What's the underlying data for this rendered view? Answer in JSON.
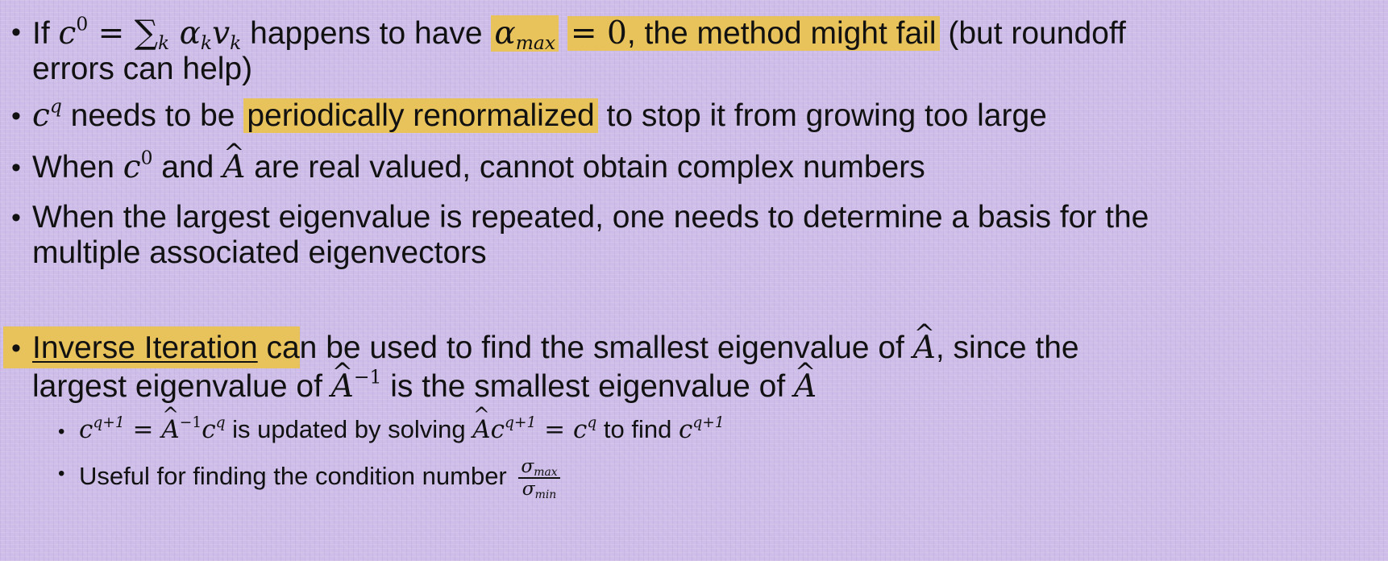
{
  "bullets": {
    "b1": {
      "t1": "If ",
      "t2": " happens to have ",
      "t3": "the method might fail",
      "t4": " (but roundoff",
      "line2": "errors can help)"
    },
    "b2": {
      "t1": " needs to be ",
      "hl": "periodically renormalized",
      "t2": " to stop it from growing too large"
    },
    "b3": {
      "t1": "When ",
      "t2": " and ",
      "t3": " are real valued, cannot obtain complex numbers"
    },
    "b4": {
      "line1": "When the largest eigenvalue is repeated, one needs to determine a basis for the",
      "line2": "multiple associated eigenvectors"
    },
    "b5": {
      "link": "Inverse Iteration",
      "t1": " can be used to find the smallest eigenvalue of ",
      "t2": ", since the",
      "l2a": "largest eigenvalue of ",
      "l2b": " is the smallest eigenvalue of "
    },
    "s1": {
      "t1": " is updated by solving ",
      "t2": " to find "
    },
    "s2": {
      "t1": "Useful for finding the condition number "
    }
  },
  "highlight_color": "#e8c25a",
  "background_color": "#cdbde8"
}
